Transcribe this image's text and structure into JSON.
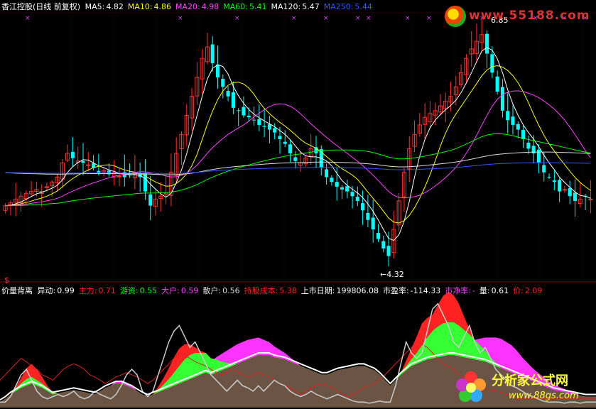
{
  "header": {
    "title": "香江控股(日线 前复权)",
    "ma": [
      {
        "label": "MA5:",
        "value": "4.82",
        "color": "#ffffff"
      },
      {
        "label": "MA10:",
        "value": "4.86",
        "color": "#ffff00"
      },
      {
        "label": "MA20:",
        "value": "4.98",
        "color": "#ff44ff"
      },
      {
        "label": "MA60:",
        "value": "5.41",
        "color": "#00ff00"
      },
      {
        "label": "MA120:",
        "value": "5.47",
        "color": "#ffffff"
      },
      {
        "label": "MA250:",
        "value": "5.44",
        "color": "#3355ff"
      }
    ]
  },
  "indicator": {
    "name": "价量背离",
    "items": [
      {
        "label": "异动:",
        "value": "0.99",
        "color": "#ffffff"
      },
      {
        "label": "主力:",
        "value": "0.71",
        "color": "#ff2222"
      },
      {
        "label": "游资:",
        "value": "0.55",
        "color": "#00ff00"
      },
      {
        "label": "大户:",
        "value": "0.59",
        "color": "#ff44ff"
      },
      {
        "label": "散户:",
        "value": "0.56",
        "color": "#dddddd"
      },
      {
        "label": "持股成本:",
        "value": "5.38",
        "color": "#ff2222"
      },
      {
        "label": "上市日期:",
        "value": "199806.08",
        "color": "#ffffff"
      },
      {
        "label": "市盈率:",
        "value": "-114.33",
        "color": "#ffffff"
      },
      {
        "label": "市净率:",
        "value": "-",
        "color": "#ff44ff"
      },
      {
        "label": "量:",
        "value": "0.61",
        "color": "#ffffff"
      },
      {
        "label": "价:",
        "value": "2.09",
        "color": "#ff2222"
      }
    ]
  },
  "annotations": {
    "high": "6.85",
    "low": "←4.32",
    "dollar": "$"
  },
  "watermarks": {
    "top": "www.55188.com",
    "bottom_title": "分析家公式网",
    "bottom_url": "www.88gs.com"
  },
  "colors": {
    "up": "#ff3333",
    "down": "#00ffff",
    "ma5": "#ffffff",
    "ma10": "#ffff00",
    "ma20": "#ff44ff",
    "ma60": "#00ff00",
    "ma120": "#dddddd",
    "ma250": "#3355ff"
  },
  "chart_data": [
    {
      "type": "candlestick",
      "title": "香江控股(日线 前复权)",
      "ylim": [
        4.2,
        6.95
      ],
      "annotations": [
        {
          "label": "6.85",
          "y": 6.85,
          "day": 93
        },
        {
          "label": "4.32",
          "y": 4.32,
          "day": 74
        }
      ],
      "closes": [
        4.95,
        4.98,
        5.02,
        5.05,
        5.08,
        5.1,
        5.12,
        5.1,
        5.15,
        5.2,
        5.25,
        5.4,
        5.5,
        5.45,
        5.42,
        5.4,
        5.38,
        5.35,
        5.3,
        5.32,
        5.28,
        5.3,
        5.26,
        5.25,
        5.28,
        5.3,
        5.25,
        5.1,
        4.95,
        5.02,
        5.05,
        5.08,
        5.3,
        5.5,
        5.7,
        5.9,
        6.1,
        6.3,
        6.5,
        6.62,
        6.45,
        6.3,
        6.2,
        6.1,
        5.98,
        5.95,
        5.9,
        5.88,
        5.85,
        5.8,
        5.78,
        5.75,
        5.72,
        5.65,
        5.6,
        5.5,
        5.42,
        5.4,
        5.45,
        5.55,
        5.5,
        5.35,
        5.25,
        5.2,
        5.15,
        5.12,
        5.1,
        5.05,
        5.0,
        4.9,
        4.8,
        4.7,
        4.6,
        4.5,
        4.42,
        4.7,
        5.0,
        5.3,
        5.55,
        5.7,
        5.8,
        5.88,
        5.92,
        5.95,
        6.0,
        6.05,
        6.1,
        6.2,
        6.35,
        6.5,
        6.6,
        6.68,
        6.75,
        6.55,
        6.35,
        6.15,
        5.95,
        5.85,
        5.8,
        5.75,
        5.65,
        5.55,
        5.5,
        5.4,
        5.3,
        5.25,
        5.2,
        5.1,
        5.12,
        5.05,
        5.0,
        5.02,
        5.05,
        5.02
      ],
      "ma": [
        {
          "name": "MA5",
          "period": 5
        },
        {
          "name": "MA10",
          "period": 10
        },
        {
          "name": "MA20",
          "period": 20
        },
        {
          "name": "MA60",
          "period": 60
        },
        {
          "name": "MA120",
          "period": 120
        },
        {
          "name": "MA250",
          "period": 250
        }
      ]
    },
    {
      "type": "area",
      "title": "价量背离",
      "ylim": [
        0,
        1
      ],
      "series": [
        {
          "name": "散户",
          "values": [
            0.05,
            0.08,
            0.12,
            0.15,
            0.18,
            0.2,
            0.22,
            0.2,
            0.18,
            0.15,
            0.12,
            0.13,
            0.14,
            0.15,
            0.16,
            0.15,
            0.14,
            0.13,
            0.12,
            0.15,
            0.18,
            0.2,
            0.22,
            0.22,
            0.2,
            0.18,
            0.15,
            0.12,
            0.1,
            0.12,
            0.14,
            0.16,
            0.18,
            0.2,
            0.22,
            0.24,
            0.26,
            0.28,
            0.3,
            0.32,
            0.3,
            0.32,
            0.34,
            0.36,
            0.38,
            0.4,
            0.42,
            0.44,
            0.46,
            0.48,
            0.48,
            0.48,
            0.46,
            0.45,
            0.44,
            0.42,
            0.4,
            0.38,
            0.36,
            0.34,
            0.32,
            0.3,
            0.3,
            0.32,
            0.34,
            0.35,
            0.36,
            0.37,
            0.38,
            0.38,
            0.36,
            0.34,
            0.3,
            0.25,
            0.2,
            0.25,
            0.3,
            0.34,
            0.38,
            0.4,
            0.42,
            0.44,
            0.45,
            0.46,
            0.47,
            0.48,
            0.48,
            0.47,
            0.46,
            0.45,
            0.44,
            0.43,
            0.42,
            0.4,
            0.38,
            0.36,
            0.34,
            0.32,
            0.3,
            0.28,
            0.26,
            0.24,
            0.22,
            0.2,
            0.18,
            0.16,
            0.15,
            0.14,
            0.13,
            0.12,
            0.11,
            0.1,
            0.1,
            0.1
          ]
        },
        {
          "name": "大户",
          "values": [
            0,
            0,
            0,
            0,
            0,
            0,
            0.02,
            0.03,
            0.04,
            0.03,
            0.02,
            0,
            0,
            0,
            0,
            0,
            0,
            0,
            0,
            0,
            0,
            0,
            0.02,
            0.03,
            0.03,
            0.02,
            0,
            0,
            0,
            0,
            0,
            0,
            0,
            0,
            0,
            0.02,
            0.04,
            0.06,
            0.08,
            0.1,
            0.12,
            0.14,
            0.15,
            0.16,
            0.17,
            0.18,
            0.18,
            0.18,
            0.17,
            0.16,
            0.14,
            0.12,
            0.1,
            0.08,
            0.06,
            0.04,
            0.02,
            0,
            0,
            0,
            0,
            0,
            0,
            0,
            0,
            0,
            0,
            0,
            0,
            0,
            0,
            0,
            0,
            0,
            0,
            0,
            0,
            0,
            0,
            0,
            0,
            0,
            0,
            0.05,
            0.08,
            0.1,
            0.12,
            0.14,
            0.15,
            0.16,
            0.18,
            0.2,
            0.22,
            0.24,
            0.26,
            0.27,
            0.26,
            0.25,
            0.22,
            0.18,
            0.15,
            0.12,
            0.1,
            0.08,
            0.06,
            0.05,
            0.04,
            0.03,
            0.02,
            0.01,
            0,
            0,
            0,
            0
          ]
        },
        {
          "name": "游资",
          "values": [
            0,
            0,
            0,
            0.02,
            0.04,
            0.06,
            0.06,
            0.05,
            0.04,
            0.03,
            0.02,
            0,
            0,
            0,
            0,
            0,
            0,
            0,
            0,
            0,
            0,
            0,
            0,
            0,
            0,
            0,
            0,
            0,
            0,
            0,
            0.02,
            0.05,
            0.08,
            0.12,
            0.16,
            0.2,
            0.22,
            0.22,
            0.2,
            0.18,
            0.15,
            0.12,
            0.08,
            0.05,
            0.02,
            0,
            0,
            0,
            0,
            0,
            0,
            0,
            0,
            0,
            0,
            0,
            0,
            0,
            0,
            0,
            0,
            0,
            0,
            0,
            0,
            0,
            0,
            0,
            0,
            0,
            0,
            0,
            0,
            0,
            0,
            0,
            0.02,
            0.04,
            0.06,
            0.1,
            0.15,
            0.2,
            0.25,
            0.28,
            0.3,
            0.3,
            0.3,
            0.28,
            0.25,
            0.22,
            0.18,
            0.14,
            0.1,
            0.06,
            0.03,
            0,
            0,
            0,
            0,
            0,
            0,
            0,
            0,
            0,
            0,
            0,
            0,
            0,
            0,
            0,
            0,
            0,
            0,
            0
          ]
        },
        {
          "name": "主力",
          "values": [
            0,
            0,
            0,
            0.02,
            0.05,
            0.1,
            0.12,
            0.1,
            0.06,
            0.02,
            0,
            0,
            0,
            0,
            0,
            0,
            0,
            0,
            0,
            0,
            0,
            0,
            0,
            0,
            0,
            0,
            0,
            0,
            0,
            0,
            0.03,
            0.06,
            0.1,
            0.14,
            0.16,
            0.14,
            0.1,
            0.05,
            0.02,
            0,
            0,
            0,
            0,
            0,
            0,
            0,
            0,
            0,
            0,
            0,
            0,
            0,
            0,
            0,
            0,
            0,
            0,
            0,
            0,
            0,
            0,
            0,
            0,
            0,
            0,
            0,
            0,
            0,
            0,
            0,
            0,
            0,
            0,
            0,
            0,
            0,
            0,
            0.05,
            0.1,
            0.15,
            0.2,
            0.18,
            0.15,
            0.2,
            0.25,
            0.28,
            0.25,
            0.2,
            0.12,
            0.05,
            0,
            0,
            0,
            0,
            0,
            0,
            0,
            0,
            0,
            0,
            0,
            0,
            0,
            0,
            0,
            0,
            0,
            0,
            0,
            0,
            0,
            0,
            0,
            0
          ]
        },
        {
          "name": "异动",
          "values": [
            0.05,
            0.05,
            0.1,
            0.2,
            0.3,
            0.35,
            0.25,
            0.15,
            0.1,
            0.08,
            0.1,
            0.12,
            0.1,
            0.12,
            0.15,
            0.1,
            0.08,
            0.1,
            0.15,
            0.12,
            0.1,
            0.08,
            0.12,
            0.2,
            0.3,
            0.35,
            0.3,
            0.15,
            0.1,
            0.15,
            0.3,
            0.45,
            0.6,
            0.7,
            0.75,
            0.65,
            0.55,
            0.6,
            0.5,
            0.4,
            0.3,
            0.25,
            0.2,
            0.15,
            0.2,
            0.25,
            0.2,
            0.18,
            0.15,
            0.2,
            0.15,
            0.2,
            0.25,
            0.22,
            0.2,
            0.15,
            0.12,
            0.1,
            0.12,
            0.15,
            0.12,
            0.1,
            0.08,
            0.1,
            0.12,
            0.1,
            0.08,
            0.06,
            0.05,
            0.05,
            0.04,
            0.05,
            0.06,
            0.05,
            0.05,
            0.2,
            0.4,
            0.6,
            0.5,
            0.45,
            0.5,
            0.7,
            0.9,
            0.95,
            0.85,
            0.75,
            0.6,
            0.55,
            0.65,
            0.75,
            0.6,
            0.5,
            0.55,
            0.45,
            0.35,
            0.3,
            0.25,
            0.2,
            0.18,
            0.15,
            0.12,
            0.1,
            0.08,
            0.06,
            0.05,
            0.05,
            0.05,
            0.04,
            0.05,
            0.05,
            0.04,
            0.05,
            0.05,
            0.05
          ]
        },
        {
          "name": "持股成本",
          "values": [
            0.25,
            0.3,
            0.35,
            0.4,
            0.45,
            0.42,
            0.38,
            0.35,
            0.3,
            0.28,
            0.25,
            0.3,
            0.35,
            0.38,
            0.4,
            0.38,
            0.35,
            0.3,
            0.28,
            0.25,
            0.22,
            0.25,
            0.28,
            0.3,
            0.32,
            0.3,
            0.28,
            0.25,
            0.22,
            0.25,
            0.3,
            0.35,
            0.4,
            0.45,
            0.5,
            0.48,
            0.45,
            0.42,
            0.4,
            0.38,
            0.35,
            0.32,
            0.3,
            0.32,
            0.35,
            0.33,
            0.3,
            0.28,
            0.3,
            0.32,
            0.3,
            0.28,
            0.25,
            0.22,
            0.2,
            0.18,
            0.15,
            0.12,
            0.15,
            0.18,
            0.2,
            0.22,
            0.2,
            0.18,
            0.15,
            0.12,
            0.1,
            0.12,
            0.15,
            0.18,
            0.2,
            0.22,
            0.25,
            0.3,
            0.35,
            0.4,
            0.45,
            0.5,
            0.55,
            0.6,
            0.58,
            0.55,
            0.5,
            0.45,
            0.4,
            0.38,
            0.35,
            0.3,
            0.28,
            0.25,
            0.22,
            0.2,
            0.18,
            0.16,
            0.15,
            0.14,
            0.12,
            0.1,
            0.08,
            0.08,
            0.08,
            0.08,
            0.08,
            0.08,
            0.08,
            0.08,
            0.08,
            0.08,
            0.08,
            0.08,
            0.08,
            0.08,
            0.08,
            0.08
          ]
        }
      ]
    }
  ]
}
